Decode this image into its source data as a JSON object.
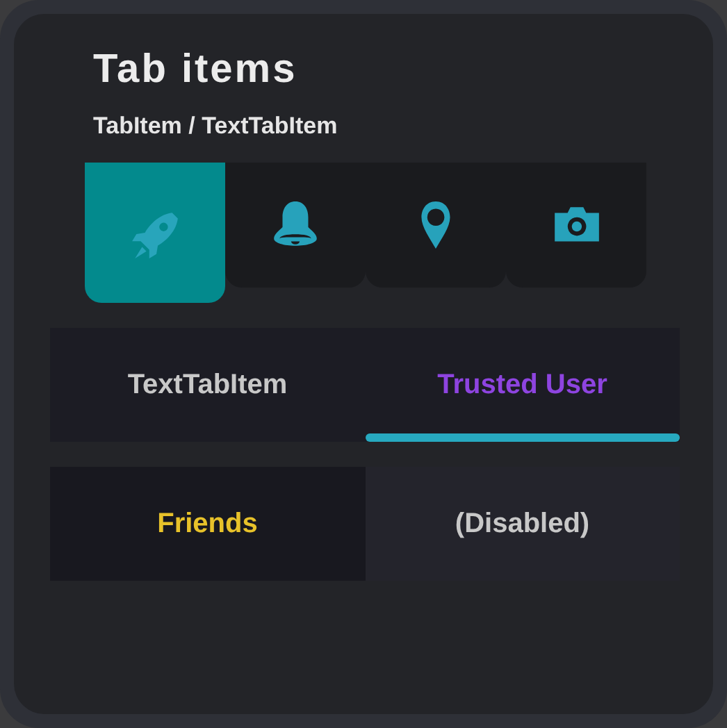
{
  "title": "Tab items",
  "subtitle": "TabItem / TextTabItem",
  "icon_tabs": [
    {
      "selected": true
    },
    {
      "selected": false
    },
    {
      "selected": false
    },
    {
      "selected": false
    }
  ],
  "text_tabs": [
    {
      "label": "TextTabItem",
      "selected": false,
      "color": "#c8c8c8"
    },
    {
      "label": "Trusted User",
      "selected": true,
      "color": "#8e44e0"
    }
  ],
  "plain_tabs": [
    {
      "label": "Friends",
      "selected": true,
      "color": "#e8c22a"
    },
    {
      "label": "(Disabled)",
      "selected": false,
      "color": "#c8c8c8"
    }
  ]
}
